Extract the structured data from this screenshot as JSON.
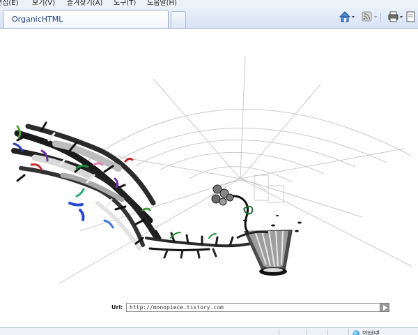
{
  "menubar": {
    "items": [
      "편집(E)",
      "보기(V)",
      "즐겨찾기(A)",
      "도구(T)",
      "도움말(H)"
    ]
  },
  "tab": {
    "title": "OrganicHTML"
  },
  "address": {
    "label": "Url:",
    "value": "http://monopiece.tistory.com"
  },
  "status": {
    "zone": "인터넷"
  },
  "colors": {
    "accent": "#1d3f73",
    "tab_border": "#98add0",
    "web_lines": "#c9c9c9"
  }
}
